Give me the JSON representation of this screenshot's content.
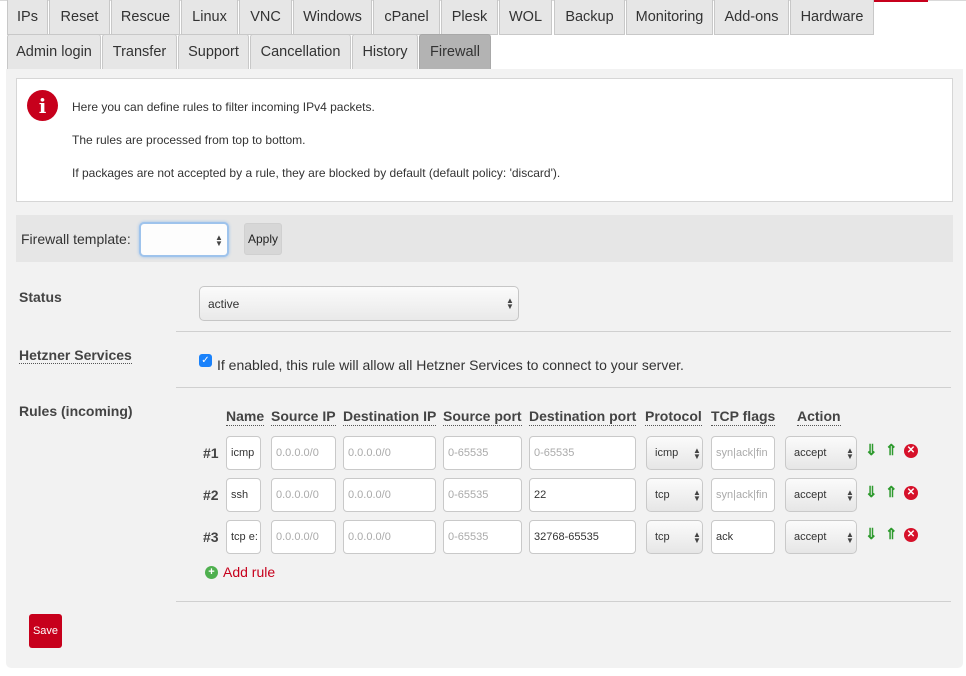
{
  "tabs_row1": [
    "IPs",
    "Reset",
    "Rescue",
    "Linux",
    "VNC",
    "Windows",
    "cPanel",
    "Plesk",
    "WOL",
    "Backup",
    "Monitoring",
    "Add-ons",
    "Hardware"
  ],
  "tabs_row2": [
    "Admin login",
    "Transfer",
    "Support",
    "Cancellation",
    "History",
    "Firewall"
  ],
  "active_tab": "Firewall",
  "info": {
    "icon": "info-icon",
    "line1": "Here you can define rules to filter incoming IPv4 packets.",
    "line2": "The rules are processed from top to bottom.",
    "line3": "If packages are not accepted by a rule, they are blocked by default (default policy: 'discard')."
  },
  "template": {
    "label": "Firewall template:",
    "selected": "",
    "apply_label": "Apply"
  },
  "status": {
    "label": "Status",
    "value": "active"
  },
  "hetzner": {
    "label": "Hetzner Services",
    "checked": true,
    "text": "If enabled, this rule will allow all Hetzner Services to connect to your server."
  },
  "rules": {
    "label": "Rules (incoming)",
    "columns": [
      "Name",
      "Source IP",
      "Destination IP",
      "Source port",
      "Destination port",
      "Protocol",
      "TCP flags",
      "Action"
    ],
    "placeholders": {
      "source_ip": "0.0.0.0/0",
      "destination_ip": "0.0.0.0/0",
      "source_port": "0-65535",
      "destination_port": "0-65535",
      "tcp_flags": "syn|ack|fin"
    },
    "rows": [
      {
        "num": "#1",
        "name": "icmp",
        "source_ip": "",
        "destination_ip": "",
        "source_port": "",
        "destination_port": "",
        "protocol": "icmp",
        "tcp_flags": "",
        "action": "accept"
      },
      {
        "num": "#2",
        "name": "ssh",
        "source_ip": "",
        "destination_ip": "",
        "source_port": "",
        "destination_port": "22",
        "protocol": "tcp",
        "tcp_flags": "",
        "action": "accept"
      },
      {
        "num": "#3",
        "name": "tcp e:",
        "source_ip": "",
        "destination_ip": "",
        "source_port": "",
        "destination_port": "32768-65535",
        "protocol": "tcp",
        "tcp_flags": "ack",
        "action": "accept"
      }
    ],
    "add_label": "Add rule"
  },
  "save_label": "Save",
  "colors": {
    "brand_red": "#c7001c",
    "arrow_green": "#2e9a2e",
    "active_tab": "#b3b3b3"
  }
}
